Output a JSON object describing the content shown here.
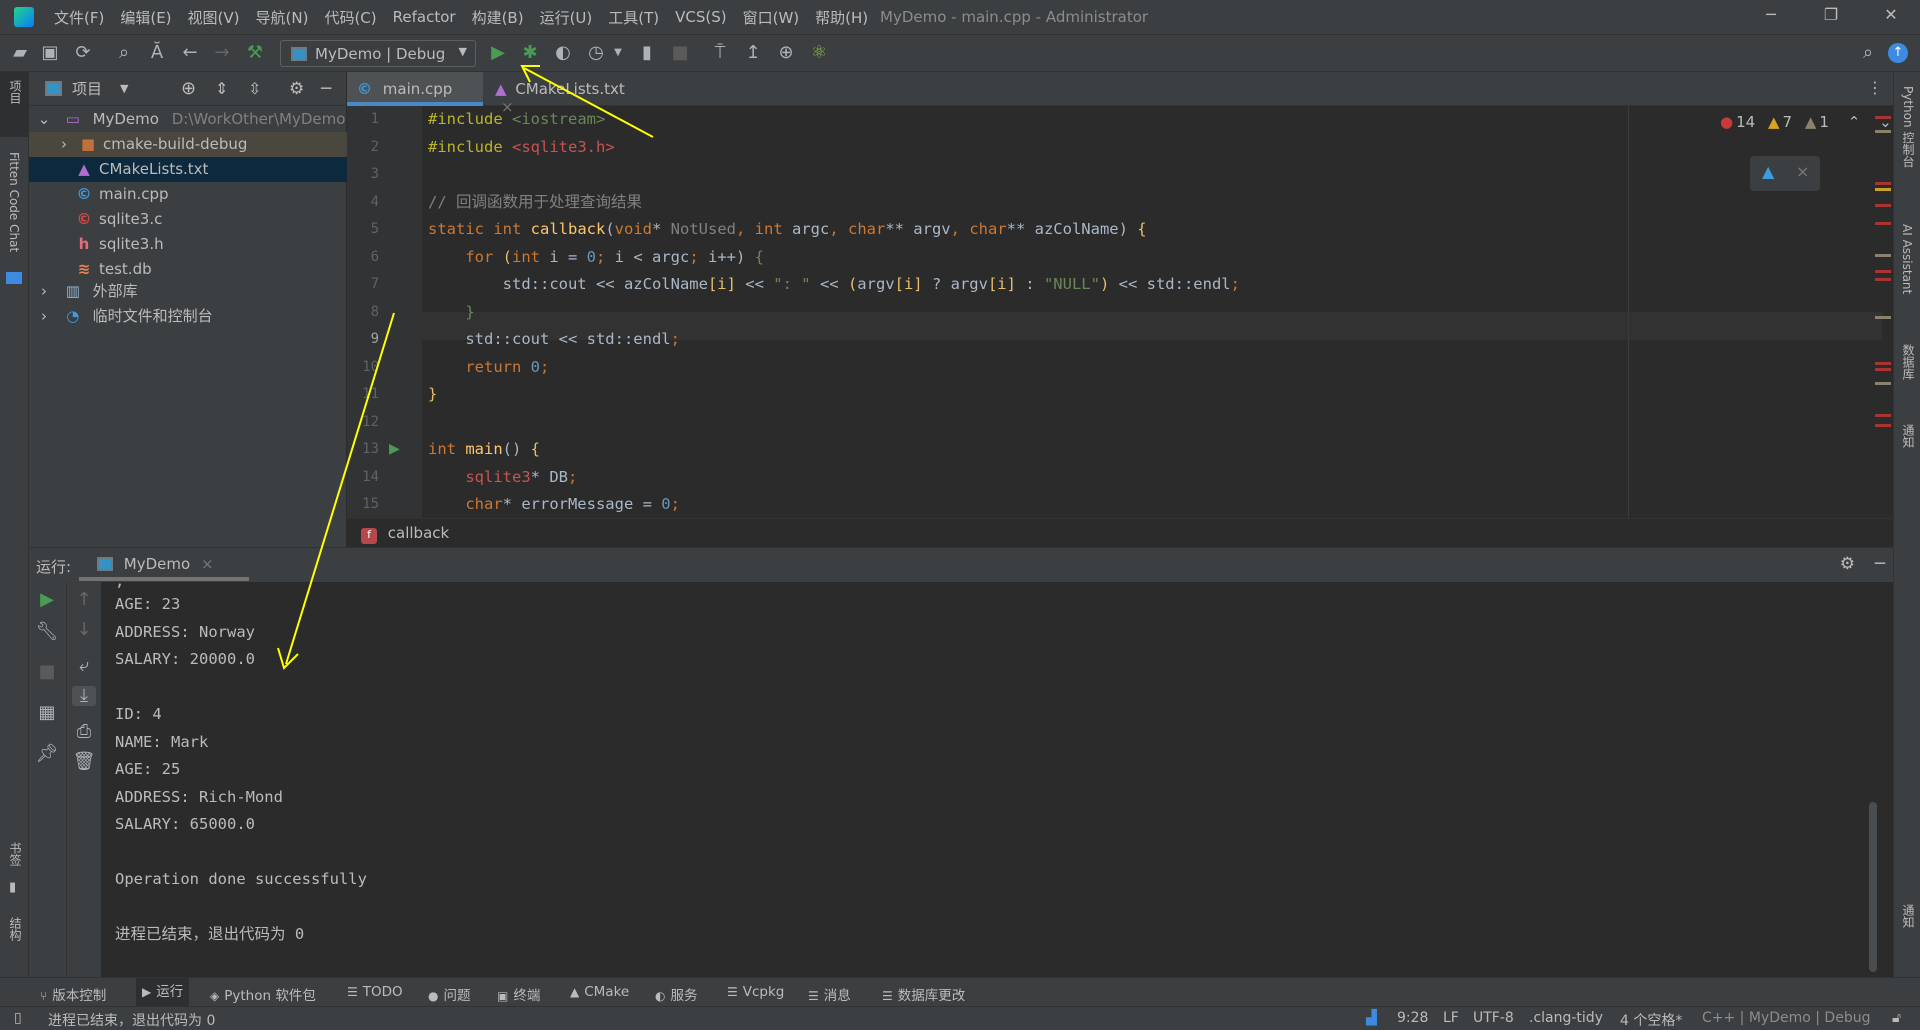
{
  "menu": [
    "文件(F)",
    "编辑(E)",
    "视图(V)",
    "导航(N)",
    "代码(C)",
    "Refactor",
    "构建(B)",
    "运行(U)",
    "工具(T)",
    "VCS(S)",
    "窗口(W)",
    "帮助(H)"
  ],
  "window_title": "MyDemo - main.cpp - Administrator",
  "toolbar": {
    "config": "MyDemo | Debug"
  },
  "left_strip": {
    "project": "项目",
    "fitten": "Fitten Code Chat",
    "bookmarks": "书签",
    "structure": "结构"
  },
  "project": {
    "title": "项目",
    "root": {
      "name": "MyDemo",
      "path": "D:\\WorkOther\\MyDemo"
    },
    "items": [
      {
        "label": "cmake-build-debug",
        "icon": "folder-icon",
        "color": "#c0703a"
      },
      {
        "label": "CMakeLists.txt",
        "icon": "cmake-icon",
        "color": "#b06fd0"
      },
      {
        "label": "main.cpp",
        "icon": "cpp-file-icon",
        "color": "#3d9be0"
      },
      {
        "label": "sqlite3.c",
        "icon": "c-file-icon",
        "color": "#e04646"
      },
      {
        "label": "sqlite3.h",
        "icon": "header-file-icon",
        "color": "#e06c75"
      },
      {
        "label": "test.db",
        "icon": "database-icon",
        "color": "#e8845a"
      }
    ],
    "external": "外部库",
    "scratches": "临时文件和控制台"
  },
  "tabs": [
    {
      "label": "main.cpp",
      "active": true
    },
    {
      "label": "CMakeLists.txt",
      "active": false
    }
  ],
  "inspections": {
    "errors": "14",
    "warnings": "7",
    "weak": "1"
  },
  "code": [
    [
      [
        "#include ",
        "inc"
      ],
      [
        "<iostream>",
        "s"
      ]
    ],
    [
      [
        "#include ",
        "inc"
      ],
      [
        "<sqlite3.h>",
        "r"
      ]
    ],
    [],
    [
      [
        "// 回调函数用于处理查询结果",
        "cm"
      ]
    ],
    [
      [
        "static int ",
        "k"
      ],
      [
        "callback",
        "fn"
      ],
      [
        "(",
        "t"
      ],
      [
        "void",
        "k"
      ],
      [
        "* ",
        "t"
      ],
      [
        "NotUsed",
        "g"
      ],
      [
        ", ",
        "k"
      ],
      [
        "int ",
        "k"
      ],
      [
        "argc",
        "t"
      ],
      [
        ", ",
        "k"
      ],
      [
        "char",
        "k"
      ],
      [
        "** argv",
        ""
      ],
      [
        ", ",
        "k"
      ],
      [
        "char",
        "k"
      ],
      [
        "** azColName) ",
        "t"
      ],
      [
        "{",
        "br"
      ]
    ],
    [
      [
        "    for ",
        "k"
      ],
      [
        "(",
        "br"
      ],
      [
        "int ",
        "k"
      ],
      [
        "i = ",
        "t"
      ],
      [
        "0",
        "n"
      ],
      [
        "; ",
        "k"
      ],
      [
        "i < argc",
        "t"
      ],
      [
        "; ",
        "k"
      ],
      [
        "i++) ",
        "t"
      ],
      [
        "{",
        "s"
      ]
    ],
    [
      [
        "        std::cout << azColName",
        "t"
      ],
      [
        "[i]",
        "br"
      ],
      [
        " << ",
        "t"
      ],
      [
        "\": \"",
        "s"
      ],
      [
        " << ",
        "t"
      ],
      [
        "(",
        "br"
      ],
      [
        "argv",
        "t"
      ],
      [
        "[i]",
        "br"
      ],
      [
        " ? argv",
        "t"
      ],
      [
        "[i]",
        "br"
      ],
      [
        " : ",
        "t"
      ],
      [
        "\"NULL\"",
        "s"
      ],
      [
        ")",
        "br"
      ],
      [
        " << std::endl",
        "t"
      ],
      [
        ";",
        "k"
      ]
    ],
    [
      [
        "    }",
        "s"
      ]
    ],
    [
      [
        "    std::cout << std::endl",
        "t"
      ],
      [
        ";",
        "k"
      ]
    ],
    [
      [
        "    return ",
        "k"
      ],
      [
        "0",
        "n"
      ],
      [
        ";",
        "k"
      ]
    ],
    [
      [
        "}",
        "br"
      ]
    ],
    [],
    [
      [
        "int ",
        "k"
      ],
      [
        "main",
        "fn"
      ],
      [
        "() ",
        "t"
      ],
      [
        "{",
        "br"
      ]
    ],
    [
      [
        "    sqlite3",
        "r"
      ],
      [
        "* DB",
        "t"
      ],
      [
        ";",
        "k"
      ]
    ],
    [
      [
        "    char",
        "k"
      ],
      [
        "* errorMessage = ",
        "t"
      ],
      [
        "0",
        "n"
      ],
      [
        ";",
        "k"
      ]
    ]
  ],
  "current_line": 9,
  "breadcrumb": "callback",
  "run": {
    "label": "运行:",
    "tab": "MyDemo",
    "output": [
      "AGE: 23",
      "ADDRESS: Norway",
      "SALARY: 20000.0",
      "",
      "ID: 4",
      "NAME: Mark",
      "AGE: 25",
      "ADDRESS: Rich-Mond",
      "SALARY: 65000.0",
      "",
      "Operation done successfully",
      "",
      "进程已结束，退出代码为 0"
    ]
  },
  "right_strip": [
    "Python 控制台",
    "AI Assistant",
    "数据库",
    "通知",
    "通知"
  ],
  "tool_windows": [
    "版本控制",
    "运行",
    "Python 软件包",
    "TODO",
    "问题",
    "终端",
    "CMake",
    "服务",
    "Vcpkg",
    "消息",
    "数据库更改"
  ],
  "status": {
    "message": "进程已结束，退出代码为 0",
    "position": "9:28",
    "line_sep": "LF",
    "encoding": "UTF-8",
    "linter": ".clang-tidy",
    "indent": "4 个空格*",
    "context": "C++ | MyDemo | Debug"
  },
  "colors": {
    "accent": "#4a88c7",
    "annotation_arrow": "#ffff00",
    "run_green": "#499c54"
  }
}
